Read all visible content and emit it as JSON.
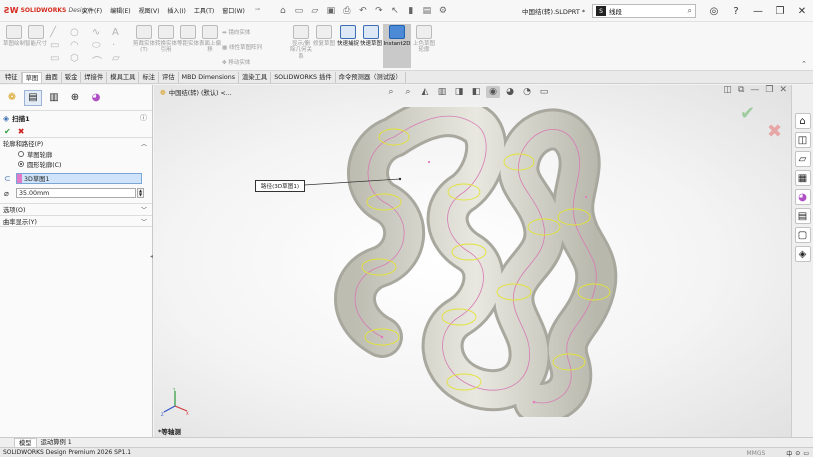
{
  "app": {
    "logo_text": "SOLIDWORKS",
    "logo_suffix": "Design",
    "document_title": "中国结(转).SLDPRT *",
    "search_placeholder": "线段"
  },
  "menu": [
    "文件(F)",
    "编辑(E)",
    "视图(V)",
    "插入(I)",
    "工具(T)",
    "窗口(W)"
  ],
  "ribbon": {
    "buttons": [
      {
        "label": "草图绘制"
      },
      {
        "label": "智能尺寸"
      },
      {
        "label": "剪裁实体(T)"
      },
      {
        "label": "转换实体引用"
      },
      {
        "label": "等距实体"
      },
      {
        "label": "表面上偏移"
      },
      {
        "label": "显示/删除几何关系"
      },
      {
        "label": "修复草图"
      },
      {
        "label": "快速捕捉"
      },
      {
        "label": "快速草图"
      },
      {
        "label": "Instant2D"
      },
      {
        "label": "上色草图轮廓"
      }
    ],
    "small_labels": [
      "镜向实体",
      "线性草图阵列",
      "移动实体"
    ]
  },
  "command_tabs": [
    "特征",
    "草图",
    "曲面",
    "钣金",
    "焊接件",
    "模具工具",
    "标注",
    "评估",
    "MBD Dimensions",
    "渲染工具",
    "SOLIDWORKS 插件",
    "命令预测器（测试版）"
  ],
  "property_manager": {
    "title": "扫描1",
    "section_profile": "轮廓和路径(P)",
    "radio_sketch": "草图轮廓",
    "radio_circle": "圆形轮廓(C)",
    "path_value": "3D草图1",
    "diameter_value": "35.00mm",
    "section_options": "选项(O)",
    "section_curvature": "曲率显示(Y)"
  },
  "viewport": {
    "tree_label": "中国结(转) (默认) <...",
    "callout_label": "路径(3D草图1)",
    "view_name": "*等轴测"
  },
  "bottom_tabs": [
    "模型",
    "运动算例 1"
  ],
  "status": {
    "version": "SOLIDWORKS Design Premium 2026 SP1.1",
    "units": "MMGS",
    "ime": "中"
  },
  "colors": {
    "brand": "#d52b1e",
    "accent": "#3b6db3",
    "selected_path": "#cfe4fb",
    "ok_green": "#2ea03a",
    "cancel_red": "#cc2222"
  }
}
